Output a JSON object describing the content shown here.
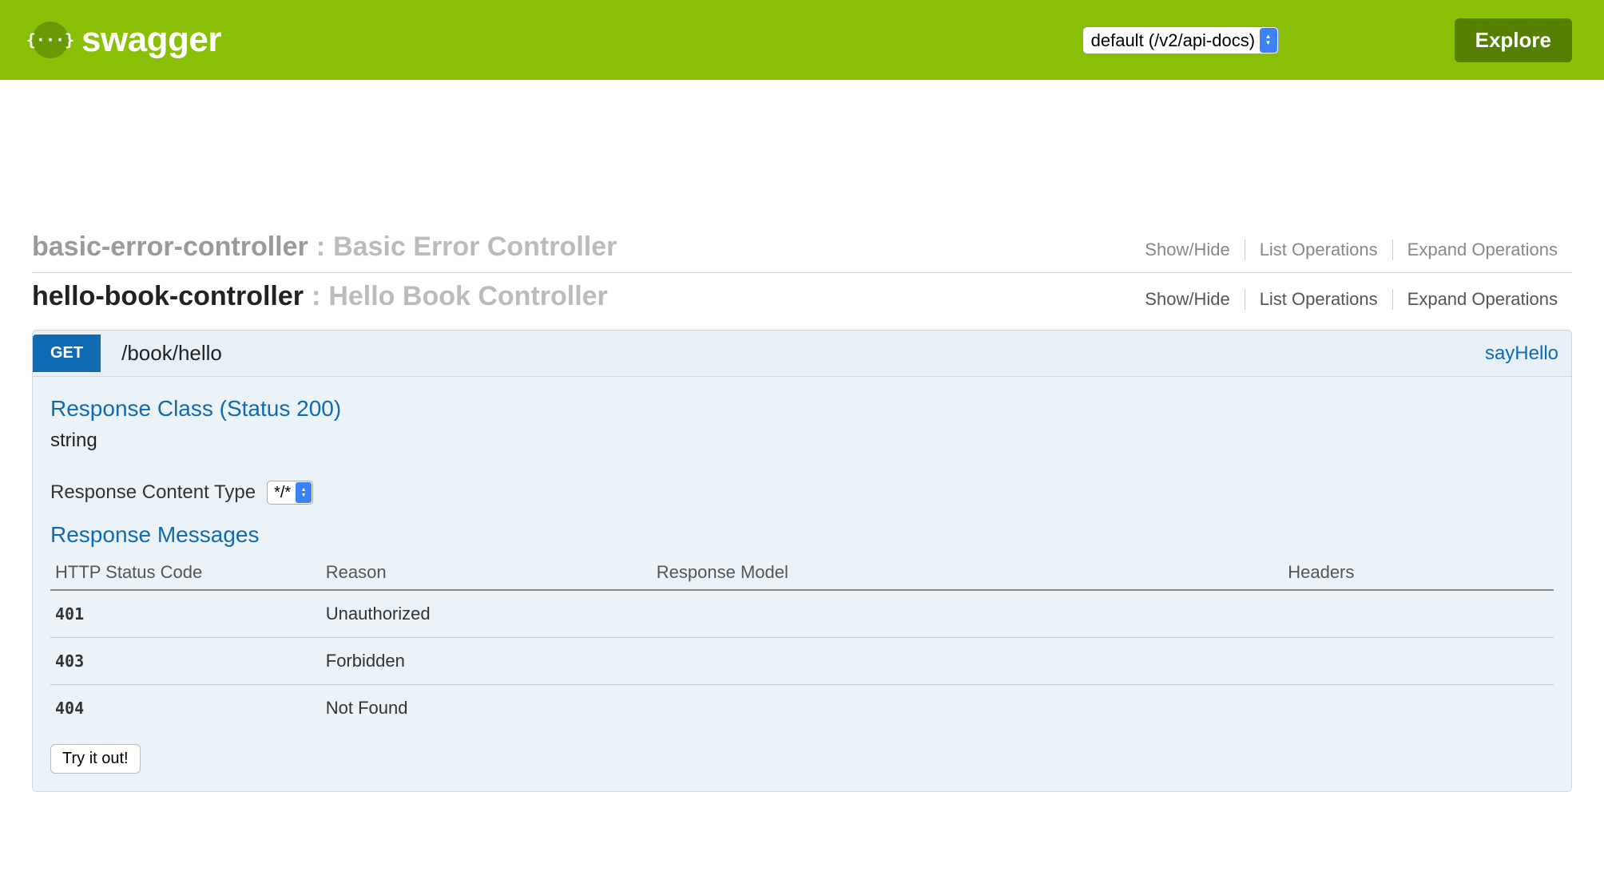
{
  "header": {
    "brand": "swagger",
    "spec_select_value": "default (/v2/api-docs)",
    "explore_label": "Explore"
  },
  "controllers": [
    {
      "id": "basic-error-controller",
      "name": "basic-error-controller",
      "description": "Basic Error Controller",
      "expanded": false,
      "links": {
        "show_hide": "Show/Hide",
        "list_ops": "List Operations",
        "expand_ops": "Expand Operations"
      }
    },
    {
      "id": "hello-book-controller",
      "name": "hello-book-controller",
      "description": "Hello Book Controller",
      "expanded": true,
      "links": {
        "show_hide": "Show/Hide",
        "list_ops": "List Operations",
        "expand_ops": "Expand Operations"
      }
    }
  ],
  "operation": {
    "method": "GET",
    "path": "/book/hello",
    "nickname": "sayHello",
    "response_class_title": "Response Class (Status 200)",
    "response_model": "string",
    "content_type_label": "Response Content Type",
    "content_type_value": "*/*",
    "response_messages_title": "Response Messages",
    "table": {
      "headers": {
        "status": "HTTP Status Code",
        "reason": "Reason",
        "model": "Response Model",
        "headers": "Headers"
      },
      "rows": [
        {
          "code": "401",
          "reason": "Unauthorized"
        },
        {
          "code": "403",
          "reason": "Forbidden"
        },
        {
          "code": "404",
          "reason": "Not Found"
        }
      ]
    },
    "try_label": "Try it out!"
  }
}
